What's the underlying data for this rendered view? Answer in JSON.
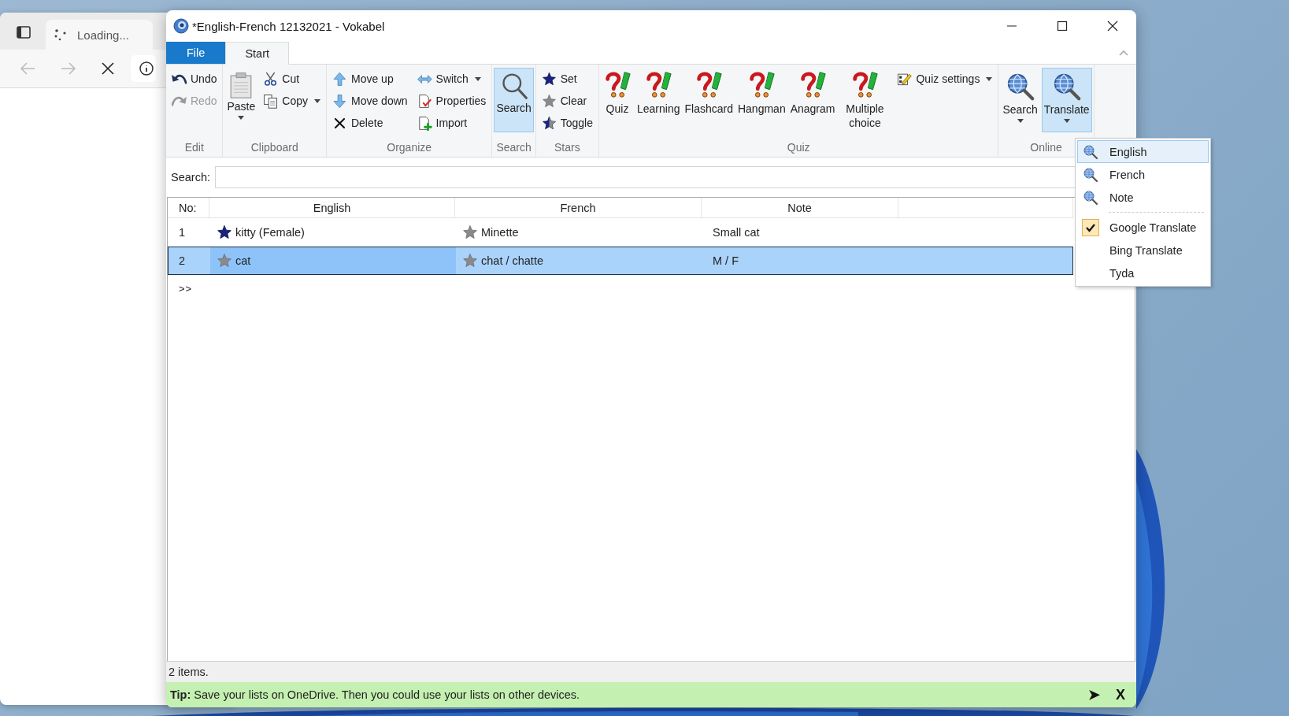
{
  "browser": {
    "tab_title": "Loading..."
  },
  "window": {
    "title": "*English-French 12132021 - Vokabel"
  },
  "tabs": [
    {
      "label": "File",
      "kind": "file",
      "selected": false
    },
    {
      "label": "Start",
      "kind": "tab",
      "selected": true
    }
  ],
  "ribbon": {
    "groups": [
      {
        "kind": "edit",
        "label": "Edit",
        "buttons": [
          {
            "label": "Undo",
            "disabled": false
          },
          {
            "label": "Redo",
            "disabled": true
          }
        ]
      },
      {
        "kind": "clipboard",
        "label": "Clipboard",
        "buttons": [
          {
            "label": "Paste",
            "dropdown": true
          },
          {
            "label": "Cut",
            "dropdown": false
          },
          {
            "label": "Copy",
            "dropdown": true
          }
        ]
      },
      {
        "kind": "organize",
        "label": "Organize",
        "buttons": [
          {
            "label": "Move up",
            "dropdown": false
          },
          {
            "label": "Move down",
            "dropdown": false
          },
          {
            "label": "Delete",
            "dropdown": false
          },
          {
            "label": "Switch",
            "dropdown": true
          },
          {
            "label": "Properties",
            "dropdown": false
          },
          {
            "label": "Import",
            "dropdown": false
          }
        ]
      },
      {
        "kind": "search",
        "label": "Search",
        "buttons": [
          {
            "label": "Search",
            "pressed": true,
            "dropdown": false
          }
        ]
      },
      {
        "kind": "stars",
        "label": "Stars",
        "buttons": [
          {
            "label": "Set"
          },
          {
            "label": "Clear"
          },
          {
            "label": "Toggle"
          }
        ]
      },
      {
        "kind": "quiz",
        "label": "Quiz",
        "buttons": [
          {
            "label": "Quiz",
            "kind": "large",
            "dropdown": false
          },
          {
            "label": "Learning",
            "kind": "large",
            "dropdown": false
          },
          {
            "label": "Flashcard",
            "kind": "large",
            "dropdown": false
          },
          {
            "label": "Hangman",
            "kind": "large",
            "dropdown": false
          },
          {
            "label": "Anagram",
            "kind": "large",
            "dropdown": false
          },
          {
            "label": "Multiple choice",
            "kind": "large",
            "dropdown": false
          },
          {
            "label": "Quiz settings",
            "kind": "small",
            "dropdown": true
          }
        ]
      },
      {
        "kind": "online",
        "label": "Online",
        "buttons": [
          {
            "label": "Search",
            "pressed": false,
            "dropdown": true
          },
          {
            "label": "Translate",
            "pressed": true,
            "dropdown": true
          }
        ]
      }
    ]
  },
  "search": {
    "label": "Search:"
  },
  "table": {
    "columns": [
      "No:",
      "English",
      "French",
      "Note"
    ],
    "rows": [
      {
        "no": "1",
        "english": {
          "text": "kitty (Female)",
          "starred": true,
          "focused": false
        },
        "french": {
          "text": "Minette",
          "starred": false,
          "focused": false
        },
        "note": "Small cat",
        "selected": false
      },
      {
        "no": "2",
        "english": {
          "text": "cat",
          "starred": false,
          "focused": true
        },
        "french": {
          "text": "chat / chatte",
          "starred": false,
          "focused": false
        },
        "note": "M / F",
        "selected": true
      }
    ],
    "new_row_marker": ">>"
  },
  "status_bar": {
    "text": "2 items."
  },
  "tip_bar": {
    "text": "**Tip:** Save your lists on OneDrive. Then you could use your lists on other devices.",
    "next": "➤",
    "close": "X"
  },
  "translate_menu": {
    "items": [
      {
        "label": "English",
        "kind": "field",
        "selected": true
      },
      {
        "label": "French",
        "kind": "field",
        "selected": false
      },
      {
        "label": "Note",
        "kind": "field",
        "selected": false
      },
      {
        "label": "Google Translate",
        "kind": "service",
        "selected": false,
        "checked": true
      },
      {
        "label": "Bing Translate",
        "kind": "service",
        "selected": false,
        "checked": false
      },
      {
        "label": "Tyda",
        "kind": "service",
        "selected": false,
        "checked": false
      }
    ]
  }
}
